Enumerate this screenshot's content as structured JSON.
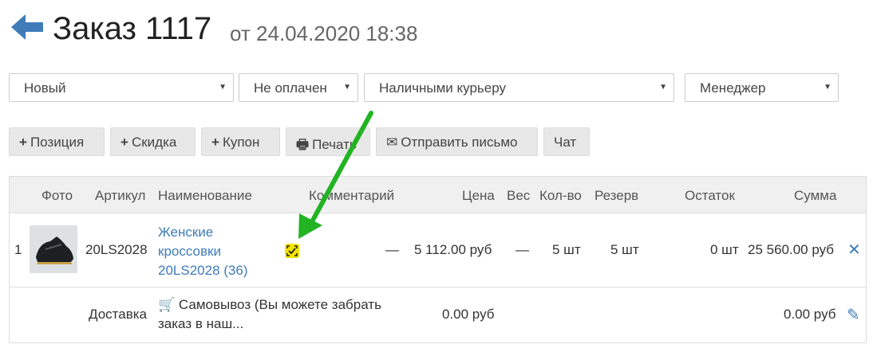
{
  "header": {
    "title": "Заказ 1117",
    "subtitle": "от 24.04.2020 18:38"
  },
  "selects": {
    "status": "Новый",
    "payment": "Не оплачен",
    "payment_method": "Наличными курьеру",
    "manager": "Менеджер"
  },
  "toolbar": {
    "add_position": "Позиция",
    "add_discount": "Скидка",
    "add_coupon": "Купон",
    "print": "Печать",
    "send_email": "Отправить письмо",
    "chat": "Чат"
  },
  "table": {
    "headers": {
      "photo": "Фото",
      "article": "Артикул",
      "name": "Наименование",
      "comment": "Комментарий",
      "price": "Цена",
      "weight": "Вес",
      "qty": "Кол-во",
      "reserve": "Резерв",
      "stock": "Остаток",
      "sum": "Сумма"
    },
    "item": {
      "num": "1",
      "article": "20LS2028",
      "name_line1": "Женские",
      "name_line2": "кроссовки",
      "name_line3": "20LS2028 (36)",
      "comment": "—",
      "price": "5 112.00 руб",
      "weight": "—",
      "qty": "5 шт",
      "reserve": "5 шт",
      "stock": "0 шт",
      "sum": "25 560.00 руб"
    },
    "delivery": {
      "label": "Доставка",
      "text_line1": "Самовывоз (Вы можете забрать",
      "text_line2": "заказ в наш...",
      "price": "0.00 руб",
      "sum": "0.00 руб"
    }
  },
  "colors": {
    "link": "#3f7cb8",
    "back_arrow": "#3f7cb8",
    "comment_icon": "#f3e400",
    "annotation_arrow": "#22b422"
  }
}
